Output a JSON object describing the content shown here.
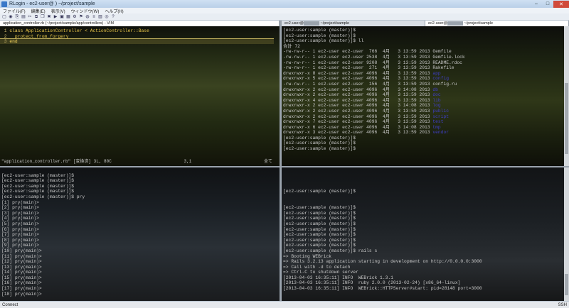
{
  "window": {
    "title": "RLogin - ec2-user@       ) ~/project/sample",
    "min": "–",
    "max": "□",
    "close": "✕"
  },
  "menu": [
    "ファイル(F)",
    "編集(E)",
    "表示(V)",
    "ウィンドウ(W)",
    "ヘルプ(H)"
  ],
  "toolbar_icons": [
    "▢",
    "◉",
    "⎘",
    "▤",
    "✂",
    "⧉",
    "❐",
    "✖",
    "▶",
    "▣",
    "▦",
    "⚙",
    "⚑",
    "◍",
    "≡",
    "▥",
    "◎",
    "?"
  ],
  "tabs": {
    "vim": "application_controller.rb (~/project/sample/app/controllers) - VIM",
    "ls_a": "ec2-user@",
    "ls_a_path": "~/project/sample",
    "ls_b": "ec2-user@",
    "ls_b_path": "~/project/sample"
  },
  "vim": {
    "lines": [
      {
        "n": "1",
        "a": "class ",
        "b": "ApplicationController",
        "c": " < ActionController::Base"
      },
      {
        "n": "2",
        "a": "  ",
        "b": "protect_from_forgery",
        "c": ""
      },
      {
        "n": "3",
        "a": "end",
        "b": "",
        "c": ""
      }
    ],
    "status_left": "\"application_controller.rb\" [変換済] 3L, 80C",
    "status_pos": "3,1",
    "status_right": "全て"
  },
  "ls": {
    "lines": [
      "[ec2-user:sample (master)]$",
      "[ec2-user:sample (master)]$",
      "[ec2-user:sample (master)]$ ll",
      "合計 72",
      "-rw-rw-r-- 1 ec2-user ec2-user  766  4月   3 13:59 2013 Gemfile",
      "-rw-rw-r-- 1 ec2-user ec2-user 2538  4月   3 13:59 2013 Gemfile.lock",
      "-rw-rw-r-- 1 ec2-user ec2-user 9208  4月   3 13:59 2013 README.rdoc",
      "-rw-rw-r-- 1 ec2-user ec2-user  271  4月   3 13:59 2013 Rakefile",
      "drwxrwxr-x 8 ec2-user ec2-user 4096  4月   3 13:59 2013 app",
      "drwxrwxr-x 5 ec2-user ec2-user 4096  4月   3 13:59 2013 config",
      "-rw-rw-r-- 1 ec2-user ec2-user  156  4月   3 13:59 2013 config.ru",
      "drwxrwxr-x 2 ec2-user ec2-user 4096  4月   3 14:08 2013 db",
      "drwxrwxr-x 2 ec2-user ec2-user 4096  4月   3 13:59 2013 doc",
      "drwxrwxr-x 4 ec2-user ec2-user 4096  4月   3 13:59 2013 lib",
      "drwxrwxr-x 2 ec2-user ec2-user 4096  4月   3 14:08 2013 log",
      "drwxrwxr-x 2 ec2-user ec2-user 4096  4月   3 13:59 2013 public",
      "drwxrwxr-x 2 ec2-user ec2-user 4096  4月   3 13:59 2013 script",
      "drwxrwxr-x 7 ec2-user ec2-user 4096  4月   3 13:59 2013 test",
      "drwxrwxr-x 6 ec2-user ec2-user 4096  4月   3 14:08 2013 tmp",
      "drwxrwxr-x 3 ec2-user ec2-user 4096  4月   3 13:59 2013 vendor",
      "[ec2-user:sample (master)]$",
      "[ec2-user:sample (master)]$",
      "[ec2-user:sample (master)]$"
    ]
  },
  "pry": {
    "lines": [
      "",
      "[ec2-user:sample (master)]$",
      "[ec2-user:sample (master)]$",
      "[ec2-user:sample (master)]$",
      "[ec2-user:sample (master)]$",
      "[ec2-user:sample (master)]$ pry",
      "[1] pry(main)>",
      "[2] pry(main)>",
      "[3] pry(main)>",
      "[4] pry(main)>",
      "[5] pry(main)>",
      "[6] pry(main)>",
      "[7] pry(main)>",
      "[8] pry(main)>",
      "[9] pry(main)>",
      "[10] pry(main)>",
      "[11] pry(main)>",
      "[12] pry(main)>",
      "[13] pry(main)>",
      "[14] pry(main)>",
      "[15] pry(main)>",
      "[16] pry(main)>",
      "[17] pry(main)>",
      "[18] pry(main)>"
    ]
  },
  "rails": {
    "lines": [
      "",
      "",
      "",
      "",
      "[ec2-user:sample (master)]$",
      "",
      "",
      "[ec2-user:sample (master)]$",
      "[ec2-user:sample (master)]$",
      "[ec2-user:sample (master)]$",
      "[ec2-user:sample (master)]$",
      "[ec2-user:sample (master)]$",
      "[ec2-user:sample (master)]$",
      "[ec2-user:sample (master)]$",
      "[ec2-user:sample (master)]$",
      "[ec2-user:sample (master)]$ rails s",
      "=> Booting WEBrick",
      "=> Rails 3.2.13 application starting in development on http://0.0.0.0:3000",
      "=> Call with -d to detach",
      "=> Ctrl-C to shutdown server",
      "[2013-04-03 16:35:11] INFO  WEBrick 1.3.1",
      "[2013-04-03 16:35:11] INFO  ruby 2.0.0 (2013-02-24) [x86_64-linux]",
      "[2013-04-03 16:35:11] INFO  WEBrick::HTTPServer#start: pid=28148 port=3000"
    ]
  },
  "status": {
    "left": "Connect",
    "right": "SSH"
  }
}
